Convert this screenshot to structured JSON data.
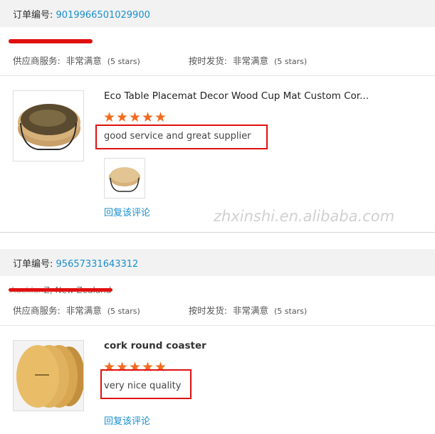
{
  "orders": [
    {
      "order_label": "订单编号:",
      "order_number": "9019966501029900",
      "supplier_service_label": "供应商服务:",
      "supplier_service_value": "非常满意",
      "supplier_service_stars": "(5 stars)",
      "shipping_label": "按时发货:",
      "shipping_value": "非常满意",
      "shipping_stars": "(5 stars)",
      "product_title": "Eco Table Placemat Decor Wood Cup Mat Custom Cor...",
      "rating": 5,
      "comment": "good service and great supplier",
      "reply_label": "回复该评论"
    },
    {
      "order_label": "订单编号:",
      "order_number": "95657331643312",
      "buyer_location_partial": "Z, New Zealand",
      "supplier_service_label": "供应商服务:",
      "supplier_service_value": "非常满意",
      "supplier_service_stars": "(5 stars)",
      "shipping_label": "按时发货:",
      "shipping_value": "非常满意",
      "shipping_stars": "(5 stars)",
      "product_title": "cork round coaster",
      "rating": 5,
      "comment": "very nice quality",
      "reply_label": "回复该评论"
    }
  ],
  "watermark": "zhxinshi.en.alibaba.com",
  "colors": {
    "link": "#1a8fd0",
    "star": "#f26b1d",
    "highlight": "#e01010",
    "header_bg": "#f2f2f2"
  }
}
